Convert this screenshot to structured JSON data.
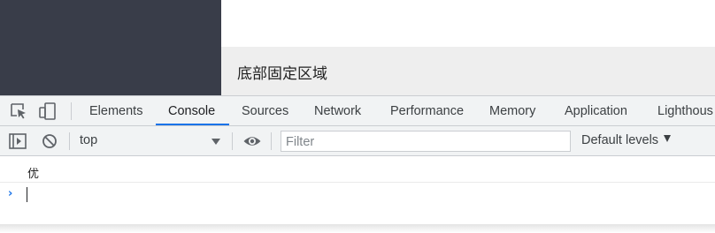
{
  "page": {
    "footer_text": "底部固定区域"
  },
  "devtools": {
    "toolbar_icons": [
      "inspect-element-icon",
      "device-toolbar-icon"
    ],
    "tabs": [
      {
        "label": "Elements"
      },
      {
        "label": "Console"
      },
      {
        "label": "Sources"
      },
      {
        "label": "Network"
      },
      {
        "label": "Performance"
      },
      {
        "label": "Memory"
      },
      {
        "label": "Application"
      },
      {
        "label": "Lighthous"
      }
    ],
    "active_tab": "Console",
    "console_toolbar": {
      "sidebar_icon": "show-sidebar-icon",
      "clear_icon": "clear-console-icon",
      "context": "top",
      "eye_icon": "live-expression-icon",
      "filter_placeholder": "Filter",
      "levels_label": "Default levels"
    },
    "console": {
      "messages": [
        {
          "text": "优"
        }
      ],
      "prompt_symbol": "›"
    }
  },
  "colors": {
    "sidebar_bg": "#393d49",
    "footer_bg": "#eeeeee",
    "devtools_bg": "#f1f3f4",
    "accent": "#1a73e8"
  }
}
